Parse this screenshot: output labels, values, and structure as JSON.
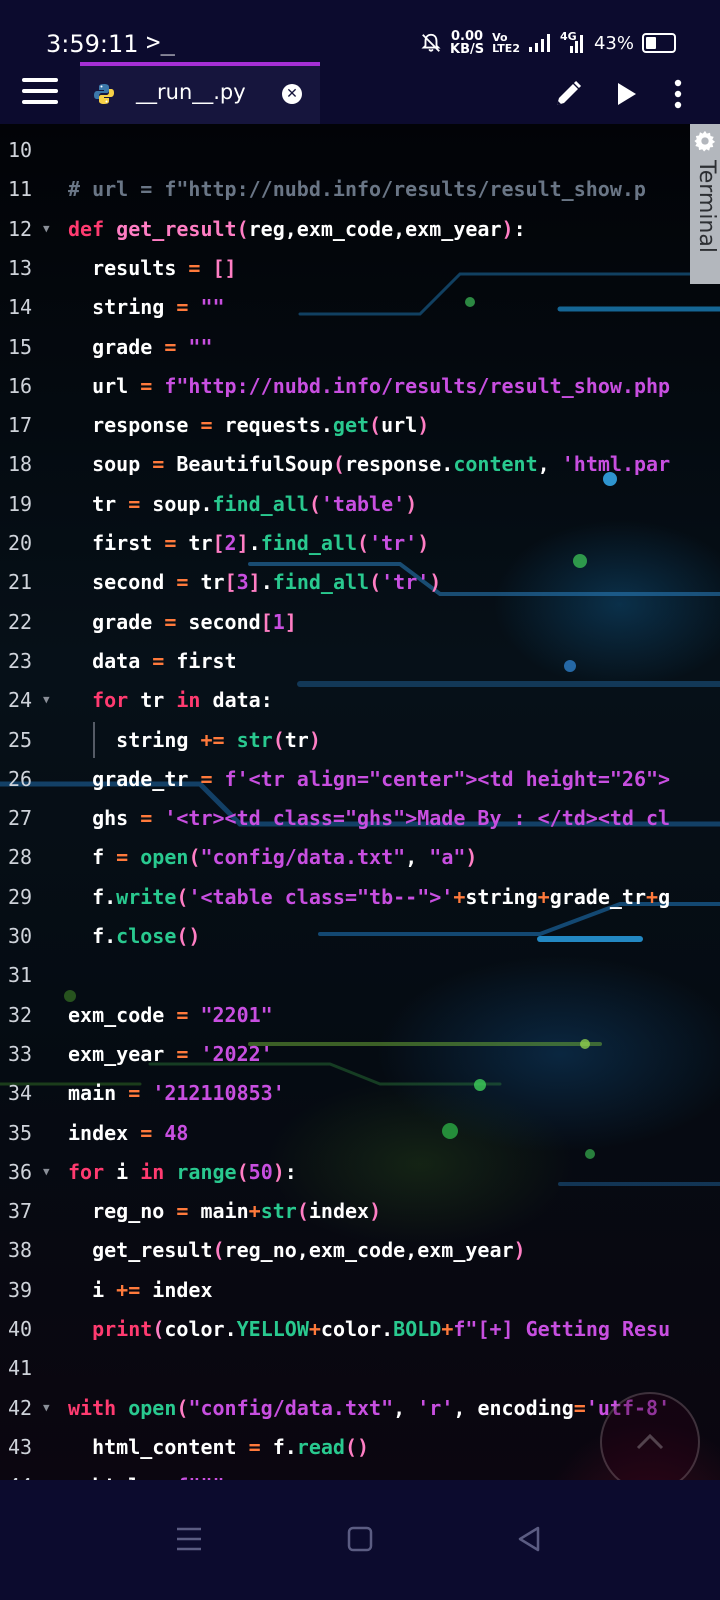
{
  "status_bar": {
    "time": "3:59:11",
    "terminal_glyph": ">_",
    "net_speed_value": "0.00",
    "net_speed_unit": "KB/S",
    "volte_top": "Vo",
    "volte_bottom": "LTE2",
    "network_type": "4G",
    "battery_percent": "43%",
    "battery_level": 0.43,
    "icons": [
      "mute-icon",
      "signal-icon",
      "signal-4g-icon",
      "battery-icon"
    ]
  },
  "toolbar": {
    "tab_label": "__run__.py",
    "tab_icon": "python-icon",
    "close_icon": "close-icon",
    "accent": "#a52fd6",
    "actions": [
      "menu-icon",
      "edit-icon",
      "run-icon",
      "more-icon"
    ]
  },
  "terminal_panel": {
    "label": "Terminal",
    "icon": "gear-icon"
  },
  "editor": {
    "lines": [
      {
        "n": "10",
        "fold": false,
        "tokens": []
      },
      {
        "n": "11",
        "fold": false,
        "tokens": [
          {
            "t": "# url = f\"http://nubd.info/results/result_show.p",
            "c": "cm"
          }
        ]
      },
      {
        "n": "12",
        "fold": true,
        "tokens": [
          {
            "t": "def ",
            "c": "kw"
          },
          {
            "t": "get_result",
            "c": "fn"
          },
          {
            "t": "(",
            "c": "br"
          },
          {
            "t": "reg,exm_code,exm_year",
            "c": "pl"
          },
          {
            "t": ")",
            "c": "br"
          },
          {
            "t": ":",
            "c": "pl"
          }
        ]
      },
      {
        "n": "13",
        "fold": false,
        "tokens": [
          {
            "t": "  results ",
            "c": "pl"
          },
          {
            "t": "=",
            "c": "op"
          },
          {
            "t": " ",
            "c": "pl"
          },
          {
            "t": "[]",
            "c": "br"
          }
        ]
      },
      {
        "n": "14",
        "fold": false,
        "tokens": [
          {
            "t": "  string ",
            "c": "pl"
          },
          {
            "t": "=",
            "c": "op"
          },
          {
            "t": " ",
            "c": "pl"
          },
          {
            "t": "\"\"",
            "c": "str"
          }
        ]
      },
      {
        "n": "15",
        "fold": false,
        "tokens": [
          {
            "t": "  grade ",
            "c": "pl"
          },
          {
            "t": "=",
            "c": "op"
          },
          {
            "t": " ",
            "c": "pl"
          },
          {
            "t": "\"\"",
            "c": "str"
          }
        ]
      },
      {
        "n": "16",
        "fold": false,
        "tokens": [
          {
            "t": "  url ",
            "c": "pl"
          },
          {
            "t": "=",
            "c": "op"
          },
          {
            "t": " ",
            "c": "pl"
          },
          {
            "t": "f\"http://nubd.info/results/result_show.php",
            "c": "str"
          }
        ]
      },
      {
        "n": "17",
        "fold": false,
        "tokens": [
          {
            "t": "  response ",
            "c": "pl"
          },
          {
            "t": "=",
            "c": "op"
          },
          {
            "t": " requests.",
            "c": "pl"
          },
          {
            "t": "get",
            "c": "call"
          },
          {
            "t": "(",
            "c": "br"
          },
          {
            "t": "url",
            "c": "pl"
          },
          {
            "t": ")",
            "c": "br"
          }
        ]
      },
      {
        "n": "18",
        "fold": false,
        "tokens": [
          {
            "t": "  soup ",
            "c": "pl"
          },
          {
            "t": "=",
            "c": "op"
          },
          {
            "t": " BeautifulSoup",
            "c": "pl"
          },
          {
            "t": "(",
            "c": "br"
          },
          {
            "t": "response.",
            "c": "pl"
          },
          {
            "t": "content",
            "c": "call"
          },
          {
            "t": ", ",
            "c": "pl"
          },
          {
            "t": "'html.par",
            "c": "str"
          }
        ]
      },
      {
        "n": "19",
        "fold": false,
        "tokens": [
          {
            "t": "  tr ",
            "c": "pl"
          },
          {
            "t": "=",
            "c": "op"
          },
          {
            "t": " soup.",
            "c": "pl"
          },
          {
            "t": "find_all",
            "c": "call"
          },
          {
            "t": "(",
            "c": "br"
          },
          {
            "t": "'table'",
            "c": "str"
          },
          {
            "t": ")",
            "c": "br"
          }
        ]
      },
      {
        "n": "20",
        "fold": false,
        "tokens": [
          {
            "t": "  first ",
            "c": "pl"
          },
          {
            "t": "=",
            "c": "op"
          },
          {
            "t": " tr",
            "c": "pl"
          },
          {
            "t": "[",
            "c": "br"
          },
          {
            "t": "2",
            "c": "num"
          },
          {
            "t": "]",
            "c": "br"
          },
          {
            "t": ".",
            "c": "pl"
          },
          {
            "t": "find_all",
            "c": "call"
          },
          {
            "t": "(",
            "c": "br"
          },
          {
            "t": "'tr'",
            "c": "str"
          },
          {
            "t": ")",
            "c": "br"
          }
        ]
      },
      {
        "n": "21",
        "fold": false,
        "tokens": [
          {
            "t": "  second ",
            "c": "pl"
          },
          {
            "t": "=",
            "c": "op"
          },
          {
            "t": " tr",
            "c": "pl"
          },
          {
            "t": "[",
            "c": "br"
          },
          {
            "t": "3",
            "c": "num"
          },
          {
            "t": "]",
            "c": "br"
          },
          {
            "t": ".",
            "c": "pl"
          },
          {
            "t": "find_all",
            "c": "call"
          },
          {
            "t": "(",
            "c": "br"
          },
          {
            "t": "'tr'",
            "c": "str"
          },
          {
            "t": ")",
            "c": "br"
          }
        ]
      },
      {
        "n": "22",
        "fold": false,
        "tokens": [
          {
            "t": "  grade ",
            "c": "pl"
          },
          {
            "t": "=",
            "c": "op"
          },
          {
            "t": " second",
            "c": "pl"
          },
          {
            "t": "[",
            "c": "br"
          },
          {
            "t": "1",
            "c": "num"
          },
          {
            "t": "]",
            "c": "br"
          }
        ]
      },
      {
        "n": "23",
        "fold": false,
        "tokens": [
          {
            "t": "  data ",
            "c": "pl"
          },
          {
            "t": "=",
            "c": "op"
          },
          {
            "t": " first",
            "c": "pl"
          }
        ]
      },
      {
        "n": "24",
        "fold": true,
        "tokens": [
          {
            "t": "  ",
            "c": "pl"
          },
          {
            "t": "for",
            "c": "kw"
          },
          {
            "t": " tr ",
            "c": "pl"
          },
          {
            "t": "in",
            "c": "kw"
          },
          {
            "t": " data:",
            "c": "pl"
          }
        ]
      },
      {
        "n": "25",
        "fold": false,
        "guide": true,
        "tokens": [
          {
            "t": "    string ",
            "c": "pl"
          },
          {
            "t": "+=",
            "c": "op"
          },
          {
            "t": " ",
            "c": "pl"
          },
          {
            "t": "str",
            "c": "call"
          },
          {
            "t": "(",
            "c": "br"
          },
          {
            "t": "tr",
            "c": "pl"
          },
          {
            "t": ")",
            "c": "br"
          }
        ]
      },
      {
        "n": "26",
        "fold": false,
        "tokens": [
          {
            "t": "  grade_tr ",
            "c": "pl"
          },
          {
            "t": "=",
            "c": "op"
          },
          {
            "t": " ",
            "c": "pl"
          },
          {
            "t": "f'<tr align=\"center\"><td height=\"26\">",
            "c": "str"
          }
        ]
      },
      {
        "n": "27",
        "fold": false,
        "tokens": [
          {
            "t": "  ghs ",
            "c": "pl"
          },
          {
            "t": "=",
            "c": "op"
          },
          {
            "t": " ",
            "c": "pl"
          },
          {
            "t": "'<tr><td class=\"ghs\">Made By : </td><td cl",
            "c": "str"
          }
        ]
      },
      {
        "n": "28",
        "fold": false,
        "tokens": [
          {
            "t": "  f ",
            "c": "pl"
          },
          {
            "t": "=",
            "c": "op"
          },
          {
            "t": " ",
            "c": "pl"
          },
          {
            "t": "open",
            "c": "call"
          },
          {
            "t": "(",
            "c": "br"
          },
          {
            "t": "\"config/data.txt\"",
            "c": "str"
          },
          {
            "t": ", ",
            "c": "pl"
          },
          {
            "t": "\"a\"",
            "c": "str"
          },
          {
            "t": ")",
            "c": "br"
          }
        ]
      },
      {
        "n": "29",
        "fold": false,
        "tokens": [
          {
            "t": "  f.",
            "c": "pl"
          },
          {
            "t": "write",
            "c": "call"
          },
          {
            "t": "(",
            "c": "br"
          },
          {
            "t": "'<table class=\"tb--\">'",
            "c": "str"
          },
          {
            "t": "+",
            "c": "op"
          },
          {
            "t": "string",
            "c": "pl"
          },
          {
            "t": "+",
            "c": "op"
          },
          {
            "t": "grade_tr",
            "c": "pl"
          },
          {
            "t": "+",
            "c": "op"
          },
          {
            "t": "g",
            "c": "pl"
          }
        ]
      },
      {
        "n": "30",
        "fold": false,
        "tokens": [
          {
            "t": "  f.",
            "c": "pl"
          },
          {
            "t": "close",
            "c": "call"
          },
          {
            "t": "()",
            "c": "br"
          }
        ]
      },
      {
        "n": "31",
        "fold": false,
        "tokens": []
      },
      {
        "n": "32",
        "fold": false,
        "tokens": [
          {
            "t": "exm_code ",
            "c": "pl"
          },
          {
            "t": "=",
            "c": "op"
          },
          {
            "t": " ",
            "c": "pl"
          },
          {
            "t": "\"2201\"",
            "c": "str"
          }
        ]
      },
      {
        "n": "33",
        "fold": false,
        "tokens": [
          {
            "t": "exm_year ",
            "c": "pl"
          },
          {
            "t": "=",
            "c": "op"
          },
          {
            "t": " ",
            "c": "pl"
          },
          {
            "t": "'2022'",
            "c": "str"
          }
        ]
      },
      {
        "n": "34",
        "fold": false,
        "tokens": [
          {
            "t": "main ",
            "c": "pl"
          },
          {
            "t": "=",
            "c": "op"
          },
          {
            "t": " ",
            "c": "pl"
          },
          {
            "t": "'212110853'",
            "c": "str"
          }
        ]
      },
      {
        "n": "35",
        "fold": false,
        "tokens": [
          {
            "t": "index ",
            "c": "pl"
          },
          {
            "t": "=",
            "c": "op"
          },
          {
            "t": " ",
            "c": "pl"
          },
          {
            "t": "48",
            "c": "num"
          }
        ]
      },
      {
        "n": "36",
        "fold": true,
        "tokens": [
          {
            "t": "for",
            "c": "kw"
          },
          {
            "t": " i ",
            "c": "pl"
          },
          {
            "t": "in",
            "c": "kw"
          },
          {
            "t": " ",
            "c": "pl"
          },
          {
            "t": "range",
            "c": "call"
          },
          {
            "t": "(",
            "c": "br"
          },
          {
            "t": "50",
            "c": "num"
          },
          {
            "t": ")",
            "c": "br"
          },
          {
            "t": ":",
            "c": "pl"
          }
        ]
      },
      {
        "n": "37",
        "fold": false,
        "tokens": [
          {
            "t": "  reg_no ",
            "c": "pl"
          },
          {
            "t": "=",
            "c": "op"
          },
          {
            "t": " main",
            "c": "pl"
          },
          {
            "t": "+",
            "c": "op"
          },
          {
            "t": "str",
            "c": "call"
          },
          {
            "t": "(",
            "c": "br"
          },
          {
            "t": "index",
            "c": "pl"
          },
          {
            "t": ")",
            "c": "br"
          }
        ]
      },
      {
        "n": "38",
        "fold": false,
        "tokens": [
          {
            "t": "  get_result",
            "c": "pl"
          },
          {
            "t": "(",
            "c": "br"
          },
          {
            "t": "reg_no,exm_code,exm_year",
            "c": "pl"
          },
          {
            "t": ")",
            "c": "br"
          }
        ]
      },
      {
        "n": "39",
        "fold": false,
        "tokens": [
          {
            "t": "  i ",
            "c": "pl"
          },
          {
            "t": "+=",
            "c": "op"
          },
          {
            "t": " index",
            "c": "pl"
          }
        ]
      },
      {
        "n": "40",
        "fold": false,
        "tokens": [
          {
            "t": "  ",
            "c": "pl"
          },
          {
            "t": "print",
            "c": "kw"
          },
          {
            "t": "(",
            "c": "br"
          },
          {
            "t": "color.",
            "c": "pl"
          },
          {
            "t": "YELLOW",
            "c": "call"
          },
          {
            "t": "+",
            "c": "op"
          },
          {
            "t": "color.",
            "c": "pl"
          },
          {
            "t": "BOLD",
            "c": "call"
          },
          {
            "t": "+",
            "c": "op"
          },
          {
            "t": "f\"[+] Getting Resu",
            "c": "str"
          }
        ]
      },
      {
        "n": "41",
        "fold": false,
        "tokens": []
      },
      {
        "n": "42",
        "fold": true,
        "tokens": [
          {
            "t": "with",
            "c": "kw"
          },
          {
            "t": " ",
            "c": "pl"
          },
          {
            "t": "open",
            "c": "call"
          },
          {
            "t": "(",
            "c": "br"
          },
          {
            "t": "\"config/data.txt\"",
            "c": "str"
          },
          {
            "t": ", ",
            "c": "pl"
          },
          {
            "t": "'r'",
            "c": "str"
          },
          {
            "t": ", encoding",
            "c": "pl"
          },
          {
            "t": "=",
            "c": "op"
          },
          {
            "t": "'utf-8'",
            "c": "str"
          }
        ]
      },
      {
        "n": "43",
        "fold": false,
        "tokens": [
          {
            "t": "  html_content ",
            "c": "pl"
          },
          {
            "t": "=",
            "c": "op"
          },
          {
            "t": " f.",
            "c": "pl"
          },
          {
            "t": "read",
            "c": "call"
          },
          {
            "t": "()",
            "c": "br"
          }
        ]
      },
      {
        "n": "44",
        "fold": false,
        "tokens": [
          {
            "t": "  html ",
            "c": "pl"
          },
          {
            "t": "=",
            "c": "op"
          },
          {
            "t": " ",
            "c": "pl"
          },
          {
            "t": "f\"\"\"",
            "c": "str"
          }
        ]
      }
    ]
  },
  "scroll_button": {
    "icon": "chevron-up-icon"
  },
  "nav_bar": {
    "icons": [
      "recent-apps-icon",
      "home-icon",
      "back-icon"
    ]
  }
}
